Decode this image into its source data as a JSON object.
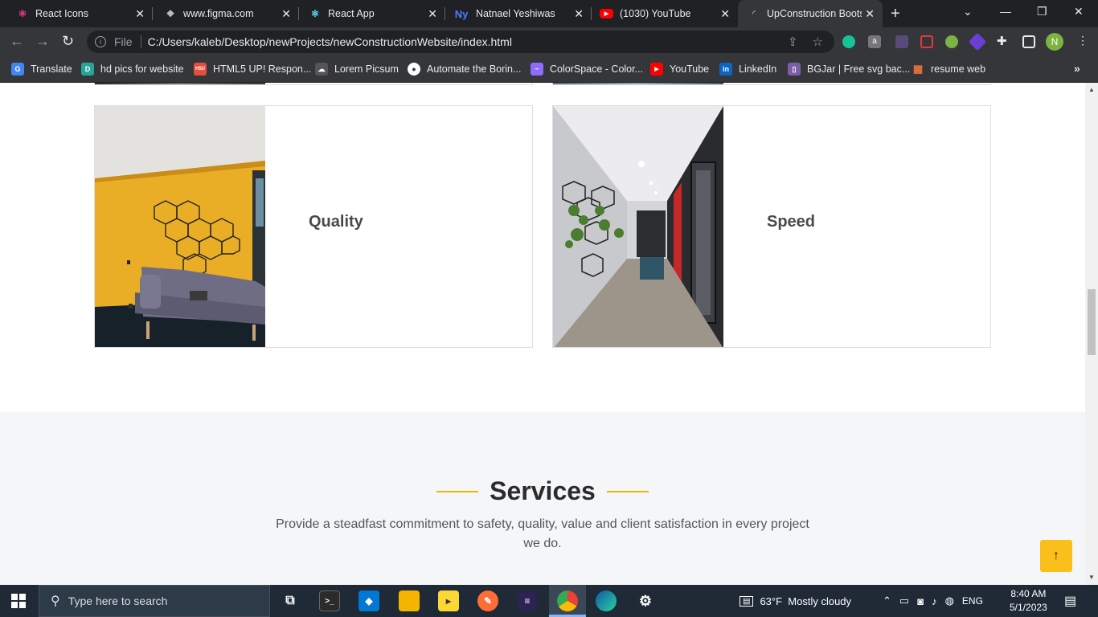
{
  "tabs": [
    {
      "label": "React Icons",
      "icon": "react-icon",
      "color": "#e83e8c"
    },
    {
      "label": "www.figma.com",
      "icon": "figma-icon",
      "color": "#bbbbbb"
    },
    {
      "label": "React App",
      "icon": "react-icon",
      "color": "#61dafb"
    },
    {
      "label": "Natnael Yeshiwas",
      "icon": "ny-icon",
      "color": "#4a7cff",
      "glyph": "Ny"
    },
    {
      "label": "(1030) YouTube",
      "icon": "youtube-icon",
      "color": "#ff0000"
    },
    {
      "label": "UpConstruction Bootst",
      "icon": "loading-icon",
      "color": "#9aa0a6"
    }
  ],
  "toolbar": {
    "file_label": "File",
    "url": "C:/Users/kaleb/Desktop/newProjects/newConstructionWebsite/index.html",
    "profile_initial": "N"
  },
  "bookmarks": [
    {
      "label": "Translate",
      "color": "#4285f4",
      "glyph": "G"
    },
    {
      "label": "hd pics for website",
      "color": "#26a69a",
      "glyph": "D"
    },
    {
      "label": "HTML5 UP! Respon...",
      "color": "#e84c3d",
      "glyph": "H5U"
    },
    {
      "label": "Lorem Picsum",
      "color": "#555555",
      "glyph": "☁"
    },
    {
      "label": "Automate the Borin...",
      "color": "#ffffff",
      "glyph": "●"
    },
    {
      "label": "ColorSpace - Color...",
      "color": "#8e6bff",
      "glyph": "~"
    },
    {
      "label": "YouTube",
      "color": "#ff0000",
      "glyph": "▶"
    },
    {
      "label": "LinkedIn",
      "color": "#0a66c2",
      "glyph": "in"
    },
    {
      "label": "BGJar | Free svg bac...",
      "color": "#7b5ea7",
      "glyph": "▯"
    },
    {
      "label": "resume web",
      "color": "#e8743b",
      "glyph": "▦"
    }
  ],
  "cards": [
    {
      "title": "Quality",
      "photo": "yellow-room-photo"
    },
    {
      "title": "Speed",
      "photo": "hallway-photo"
    }
  ],
  "services": {
    "title": "Services",
    "description": "Provide a steadfast commitment to safety, quality, value and client satisfaction in every project we do.",
    "accent": "#f2b705"
  },
  "back_to_top": {
    "icon": "arrow-up-icon",
    "color": "#fbbf1b"
  },
  "taskbar": {
    "search_placeholder": "Type here to search",
    "weather": "63°F  Mostly cloudy",
    "lang": "ENG",
    "time": "8:40 AM",
    "date": "5/1/2023"
  }
}
